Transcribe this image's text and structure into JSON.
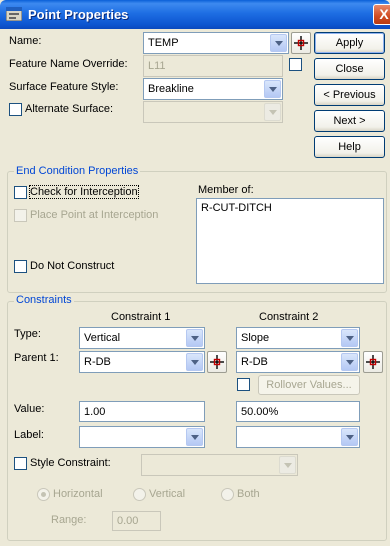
{
  "window": {
    "title": "Point Properties",
    "close_glyph": "X"
  },
  "general": {
    "name_label": "Name:",
    "name_value": "TEMP",
    "feature_override_label": "Feature Name Override:",
    "feature_override_value": "L11",
    "surface_feature_style_label": "Surface Feature Style:",
    "surface_feature_style_value": "Breakline",
    "alternate_surface_label": "Alternate Surface:",
    "alternate_surface_value": ""
  },
  "buttons": {
    "apply": "Apply",
    "close": "Close",
    "previous": "< Previous",
    "next": "Next >",
    "help": "Help"
  },
  "end_condition": {
    "title": "End Condition Properties",
    "check_interception": "Check for Interception",
    "place_point_interception": "Place Point at Interception",
    "do_not_construct": "Do Not Construct",
    "member_of_label": "Member of:",
    "member_of_items": [
      "R-CUT-DITCH"
    ]
  },
  "constraints": {
    "title": "Constraints",
    "col1_header": "Constraint 1",
    "col2_header": "Constraint 2",
    "type_label": "Type:",
    "parent_label": "Parent 1:",
    "value_label": "Value:",
    "label_label": "Label:",
    "c1": {
      "type": "Vertical",
      "parent": "R-DB",
      "value": "1.00",
      "label": ""
    },
    "c2": {
      "type": "Slope",
      "parent": "R-DB",
      "value": "50.00%",
      "label": ""
    },
    "rollover_values": "Rollover Values...",
    "style_constraint_label": "Style Constraint:",
    "style_constraint_value": "",
    "radio_horizontal": "Horizontal",
    "radio_vertical": "Vertical",
    "radio_both": "Both",
    "range_label": "Range:",
    "range_value": "0.00"
  },
  "icons": {
    "window_icon": "point-properties-icon",
    "picker": "crosshair-picker-icon",
    "dropdown": "chevron-down-icon",
    "close": "close-icon"
  },
  "colors": {
    "titlebar": "#0a5fd8",
    "dialog_bg": "#ece9d8",
    "group_title": "#0046d5",
    "close_button": "#cf4b22"
  }
}
